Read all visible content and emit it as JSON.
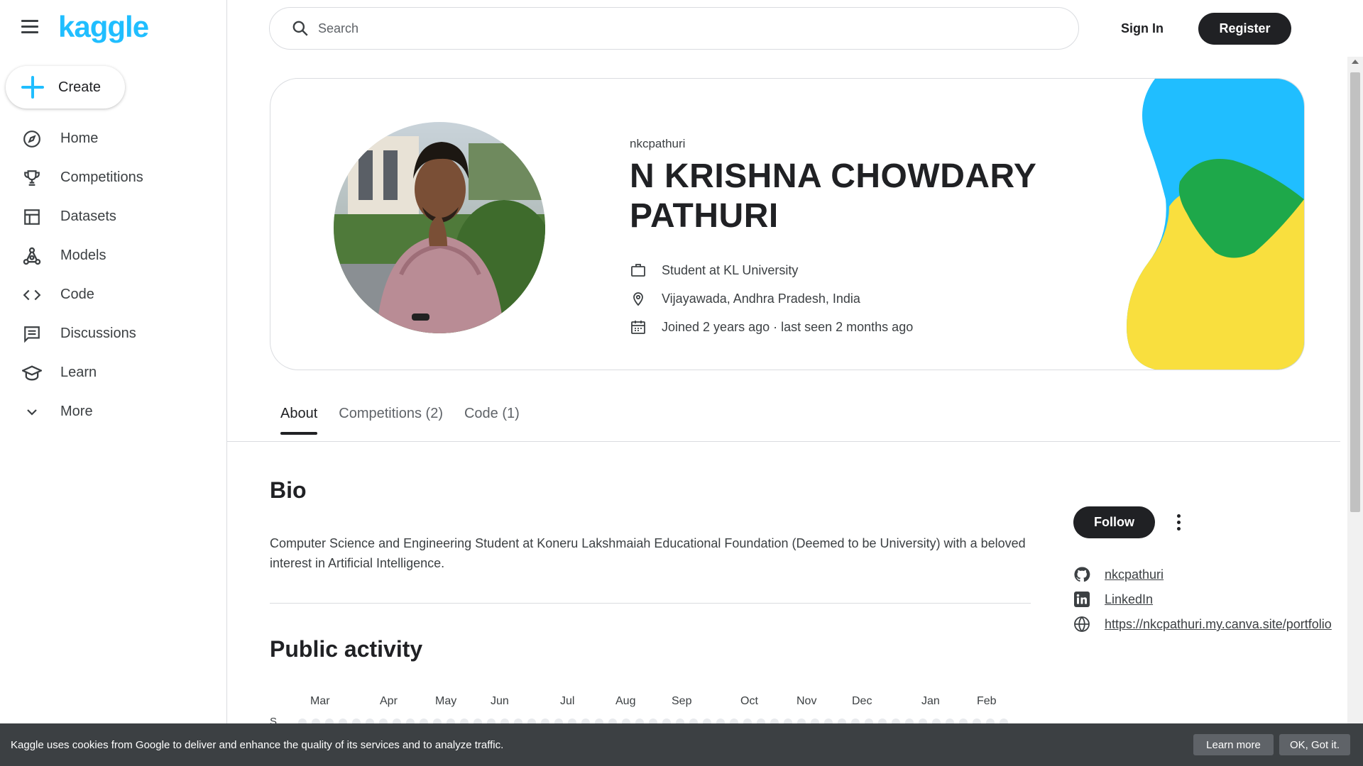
{
  "brand": {
    "logo_text": "kaggle",
    "accent_color": "#20beff"
  },
  "sidebar": {
    "create_label": "Create",
    "items": [
      {
        "label": "Home",
        "icon": "compass-icon"
      },
      {
        "label": "Competitions",
        "icon": "trophy-icon"
      },
      {
        "label": "Datasets",
        "icon": "table-icon"
      },
      {
        "label": "Models",
        "icon": "models-icon"
      },
      {
        "label": "Code",
        "icon": "code-icon"
      },
      {
        "label": "Discussions",
        "icon": "comment-icon"
      },
      {
        "label": "Learn",
        "icon": "school-icon"
      },
      {
        "label": "More",
        "icon": "chevron-down-icon"
      }
    ]
  },
  "header": {
    "search_placeholder": "Search",
    "sign_in_label": "Sign In",
    "register_label": "Register"
  },
  "profile": {
    "username": "nkcpathuri",
    "full_name": "N KRISHNA CHOWDARY PATHURI",
    "occupation": "Student at KL University",
    "location": "Vijayawada, Andhra Pradesh, India",
    "joined": "Joined 2 years ago · last seen 2 months ago"
  },
  "tabs": [
    {
      "label": "About",
      "active": true
    },
    {
      "label": "Competitions (2)",
      "active": false
    },
    {
      "label": "Code (1)",
      "active": false
    }
  ],
  "about": {
    "bio_title": "Bio",
    "bio_text": "Computer Science and Engineering Student at Koneru Lakshmaiah Educational Foundation (Deemed to be University) with a beloved interest in Artificial Intelligence.",
    "activity_title": "Public activity",
    "months": [
      "Mar",
      "Apr",
      "May",
      "Jun",
      "Jul",
      "Aug",
      "Sep",
      "Oct",
      "Nov",
      "Dec",
      "Jan",
      "Feb"
    ],
    "first_day_label": "S"
  },
  "side_panel": {
    "follow_label": "Follow",
    "links": [
      {
        "label": "nkcpathuri",
        "icon": "github-icon"
      },
      {
        "label": "LinkedIn",
        "icon": "linkedin-icon"
      },
      {
        "label": "https://nkcpathuri.my.canva.site/portfolio",
        "icon": "globe-icon"
      }
    ]
  },
  "cookie_banner": {
    "text": "Kaggle uses cookies from Google to deliver and enhance the quality of its services and to analyze traffic.",
    "learn_more_label": "Learn more",
    "ok_label": "OK, Got it."
  }
}
